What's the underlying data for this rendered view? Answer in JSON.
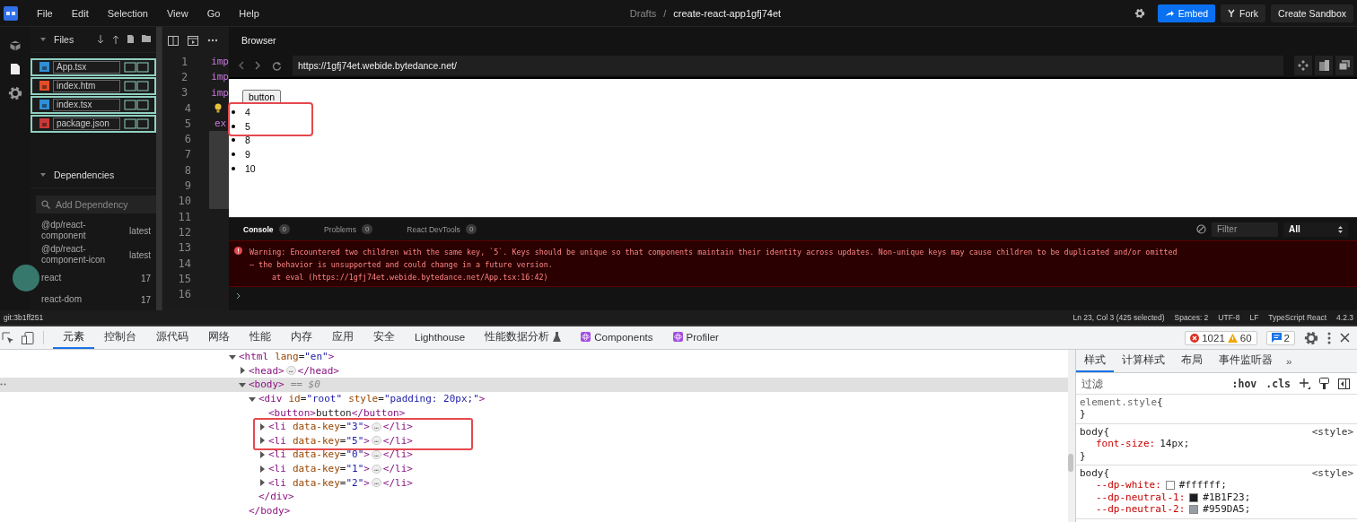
{
  "menu": [
    "File",
    "Edit",
    "Selection",
    "View",
    "Go",
    "Help"
  ],
  "breadcrumb": {
    "parent": "Drafts",
    "separator": "/",
    "title": "create-react-app1gfj74et"
  },
  "actions": [
    {
      "label": "Embed",
      "kind": "primary"
    },
    {
      "label": "Fork",
      "kind": "fork"
    },
    {
      "label": "Create Sandbox",
      "kind": "plain"
    }
  ],
  "files_panel": {
    "title": "Files",
    "expanded": true,
    "files": [
      {
        "name": "App.tsx",
        "kind": "ts"
      },
      {
        "name": "index.htm",
        "kind": "html"
      },
      {
        "name": "index.tsx",
        "kind": "ts"
      },
      {
        "name": "package.json",
        "kind": "npm"
      }
    ]
  },
  "dependencies": {
    "title": "Dependencies",
    "expanded": true,
    "placeholder": "Add Dependency",
    "items": [
      {
        "name": "@dp/react-component",
        "version": "latest"
      },
      {
        "name": "@dp/react-component-icon",
        "version": "latest"
      },
      {
        "name": "react",
        "version": "17"
      },
      {
        "name": "react-dom",
        "version": "17"
      }
    ]
  },
  "editor": {
    "lines": [
      {
        "number": "1",
        "text": "imp",
        "selected": false
      },
      {
        "number": "2",
        "text": "imp",
        "selected": false
      },
      {
        "number": "3",
        "text": "imp",
        "selected": false
      },
      {
        "number": "4",
        "lightbulb": true,
        "selected": false
      },
      {
        "number": "5",
        "text": "ex",
        "selected": false
      },
      {
        "number": "6",
        "selected": true
      },
      {
        "number": "7",
        "selected": true
      },
      {
        "number": "8",
        "selected": true
      },
      {
        "number": "9",
        "selected": true
      },
      {
        "number": "10",
        "selected": true
      },
      {
        "number": "11",
        "selected": false
      },
      {
        "number": "12",
        "selected": false
      },
      {
        "number": "13",
        "selected": false
      },
      {
        "number": "14",
        "selected": false
      },
      {
        "number": "15",
        "selected": false
      },
      {
        "number": "16",
        "selected": false
      }
    ]
  },
  "browser": {
    "title": "Browser",
    "url": "https://1gfj74et.webide.bytedance.net/",
    "page_button": "button",
    "list": [
      {
        "text": "4",
        "highlighted": true
      },
      {
        "text": "5",
        "highlighted": true
      },
      {
        "text": "8",
        "highlighted": false
      },
      {
        "text": "9",
        "highlighted": false
      },
      {
        "text": "10",
        "highlighted": false
      }
    ]
  },
  "console": {
    "tabs": [
      {
        "label": "Console",
        "count": "0",
        "selected": true
      },
      {
        "label": "Problems",
        "count": "0",
        "selected": false
      },
      {
        "label": "React DevTools",
        "count": "0",
        "selected": false
      }
    ],
    "filter_placeholder": "Filter",
    "level": "All",
    "messages": [
      {
        "kind": "error",
        "lines": [
          "Warning: Encountered two children with the same key, `5`. Keys should be unique so that components maintain their identity across updates. Non-unique keys may cause children to be duplicated and/or omitted",
          "— the behavior is unsupported and could change in a future version."
        ],
        "stack": "at eval (https://1gfj74et.webide.bytedance.net/App.tsx:16:42)"
      }
    ]
  },
  "status_bar": {
    "branch": "git:3b1ff251",
    "items": [
      "Ln 23, Col 3 (425 selected)",
      "Spaces: 2",
      "UTF-8",
      "LF",
      "TypeScript React",
      "4.2.3"
    ]
  },
  "devtools": {
    "tabs": [
      {
        "label": "元素",
        "kind": "plain",
        "selected": true
      },
      {
        "label": "控制台",
        "kind": "plain",
        "selected": false
      },
      {
        "label": "源代码",
        "kind": "plain",
        "selected": false
      },
      {
        "label": "网络",
        "kind": "plain",
        "selected": false
      },
      {
        "label": "性能",
        "kind": "plain",
        "selected": false
      },
      {
        "label": "内存",
        "kind": "plain",
        "selected": false
      },
      {
        "label": "应用",
        "kind": "plain",
        "selected": false
      },
      {
        "label": "安全",
        "kind": "plain",
        "selected": false
      },
      {
        "label": "Lighthouse",
        "kind": "plain",
        "selected": false
      },
      {
        "label": "性能数据分析",
        "kind": "experiment",
        "selected": false
      },
      {
        "label": "Components",
        "kind": "react",
        "selected": false
      },
      {
        "label": "Profiler",
        "kind": "react",
        "selected": false
      }
    ],
    "errors": "1021",
    "warnings": "60",
    "messages": "2",
    "dom_tree": [
      {
        "expanded": true,
        "selected": false,
        "highlighted": false,
        "parts": [
          {
            "kind": "tag",
            "text": "<html"
          },
          {
            "kind": "attr",
            "text": "lang"
          },
          {
            "kind": "punct",
            "text": "="
          },
          {
            "kind": "value",
            "text": "\"en\""
          },
          {
            "kind": "tag",
            "text": ">"
          }
        ],
        "children": [
          {
            "expanded": false,
            "selected": false,
            "highlighted": false,
            "parts": [
              {
                "kind": "tag",
                "text": "<head>"
              },
              {
                "kind": "ellipsis",
                "text": "…"
              },
              {
                "kind": "tag",
                "text": "</head>"
              }
            ]
          },
          {
            "expanded": true,
            "selected": true,
            "highlighted": false,
            "parts": [
              {
                "kind": "tag",
                "text": "<body>"
              },
              {
                "kind": "marker",
                "text": "== $0"
              }
            ],
            "close": [
              {
                "kind": "tag",
                "text": "</body>"
              }
            ],
            "children": [
              {
                "expanded": true,
                "selected": false,
                "highlighted": false,
                "parts": [
                  {
                    "kind": "tag",
                    "text": "<div"
                  },
                  {
                    "kind": "attr",
                    "text": "id"
                  },
                  {
                    "kind": "punct",
                    "text": "="
                  },
                  {
                    "kind": "value",
                    "text": "\"root\""
                  },
                  {
                    "kind": "attr",
                    "text": "style"
                  },
                  {
                    "kind": "punct",
                    "text": "="
                  },
                  {
                    "kind": "value",
                    "text": "\"padding: 20px;\""
                  },
                  {
                    "kind": "tag",
                    "text": ">"
                  }
                ],
                "close": [
                  {
                    "kind": "tag",
                    "text": "</div>"
                  }
                ],
                "children": [
                  {
                    "selected": false,
                    "highlighted": false,
                    "parts": [
                      {
                        "kind": "tag",
                        "text": "<button>"
                      },
                      {
                        "kind": "text",
                        "text": "button"
                      },
                      {
                        "kind": "tag",
                        "text": "</button>"
                      }
                    ]
                  },
                  {
                    "expanded": false,
                    "selected": false,
                    "highlighted": true,
                    "parts": [
                      {
                        "kind": "tag",
                        "text": "<li"
                      },
                      {
                        "kind": "attr",
                        "text": "data-key"
                      },
                      {
                        "kind": "punct",
                        "text": "="
                      },
                      {
                        "kind": "value",
                        "text": "\"3\""
                      },
                      {
                        "kind": "tag",
                        "text": ">"
                      },
                      {
                        "kind": "ellipsis",
                        "text": "…"
                      },
                      {
                        "kind": "tag",
                        "text": "</li>"
                      }
                    ]
                  },
                  {
                    "expanded": false,
                    "selected": false,
                    "highlighted": true,
                    "parts": [
                      {
                        "kind": "tag",
                        "text": "<li"
                      },
                      {
                        "kind": "attr",
                        "text": "data-key"
                      },
                      {
                        "kind": "punct",
                        "text": "="
                      },
                      {
                        "kind": "value",
                        "text": "\"5\""
                      },
                      {
                        "kind": "tag",
                        "text": ">"
                      },
                      {
                        "kind": "ellipsis",
                        "text": "…"
                      },
                      {
                        "kind": "tag",
                        "text": "</li>"
                      }
                    ]
                  },
                  {
                    "expanded": false,
                    "selected": false,
                    "highlighted": false,
                    "parts": [
                      {
                        "kind": "tag",
                        "text": "<li"
                      },
                      {
                        "kind": "attr",
                        "text": "data-key"
                      },
                      {
                        "kind": "punct",
                        "text": "="
                      },
                      {
                        "kind": "value",
                        "text": "\"0\""
                      },
                      {
                        "kind": "tag",
                        "text": ">"
                      },
                      {
                        "kind": "ellipsis",
                        "text": "…"
                      },
                      {
                        "kind": "tag",
                        "text": "</li>"
                      }
                    ]
                  },
                  {
                    "expanded": false,
                    "selected": false,
                    "highlighted": false,
                    "parts": [
                      {
                        "kind": "tag",
                        "text": "<li"
                      },
                      {
                        "kind": "attr",
                        "text": "data-key"
                      },
                      {
                        "kind": "punct",
                        "text": "="
                      },
                      {
                        "kind": "value",
                        "text": "\"1\""
                      },
                      {
                        "kind": "tag",
                        "text": ">"
                      },
                      {
                        "kind": "ellipsis",
                        "text": "…"
                      },
                      {
                        "kind": "tag",
                        "text": "</li>"
                      }
                    ]
                  },
                  {
                    "expanded": false,
                    "selected": false,
                    "highlighted": false,
                    "parts": [
                      {
                        "kind": "tag",
                        "text": "<li"
                      },
                      {
                        "kind": "attr",
                        "text": "data-key"
                      },
                      {
                        "kind": "punct",
                        "text": "="
                      },
                      {
                        "kind": "value",
                        "text": "\"2\""
                      },
                      {
                        "kind": "tag",
                        "text": ">"
                      },
                      {
                        "kind": "ellipsis",
                        "text": "…"
                      },
                      {
                        "kind": "tag",
                        "text": "</li>"
                      }
                    ]
                  }
                ]
              }
            ]
          }
        ]
      }
    ],
    "styles_tabs": [
      {
        "label": "样式",
        "selected": true
      },
      {
        "label": "计算样式",
        "selected": false
      },
      {
        "label": "布局",
        "selected": false
      },
      {
        "label": "事件监听器",
        "selected": false
      }
    ],
    "styles_more": "»",
    "filter_placeholder": "过滤",
    "hov": ":hov",
    "cls": ".cls",
    "rules": [
      {
        "selector": "element.style",
        "open": "{",
        "close": "}"
      },
      {
        "selector": "body",
        "source": "<style>",
        "open": "{",
        "close": "}",
        "declarations": [
          {
            "property": "font-size:",
            "value": "14px;"
          }
        ]
      },
      {
        "selector": "body",
        "source": "<style>",
        "open": "{",
        "declarations": [
          {
            "property": "--dp-white:",
            "value": "#ffffff;",
            "color": "#ffffff"
          },
          {
            "property": "--dp-neutral-1:",
            "value": "#1B1F23;",
            "color": "#1b1f23"
          },
          {
            "property": "--dp-neutral-2:",
            "value": "#959DA5;",
            "color": "#959da5"
          }
        ]
      }
    ]
  }
}
